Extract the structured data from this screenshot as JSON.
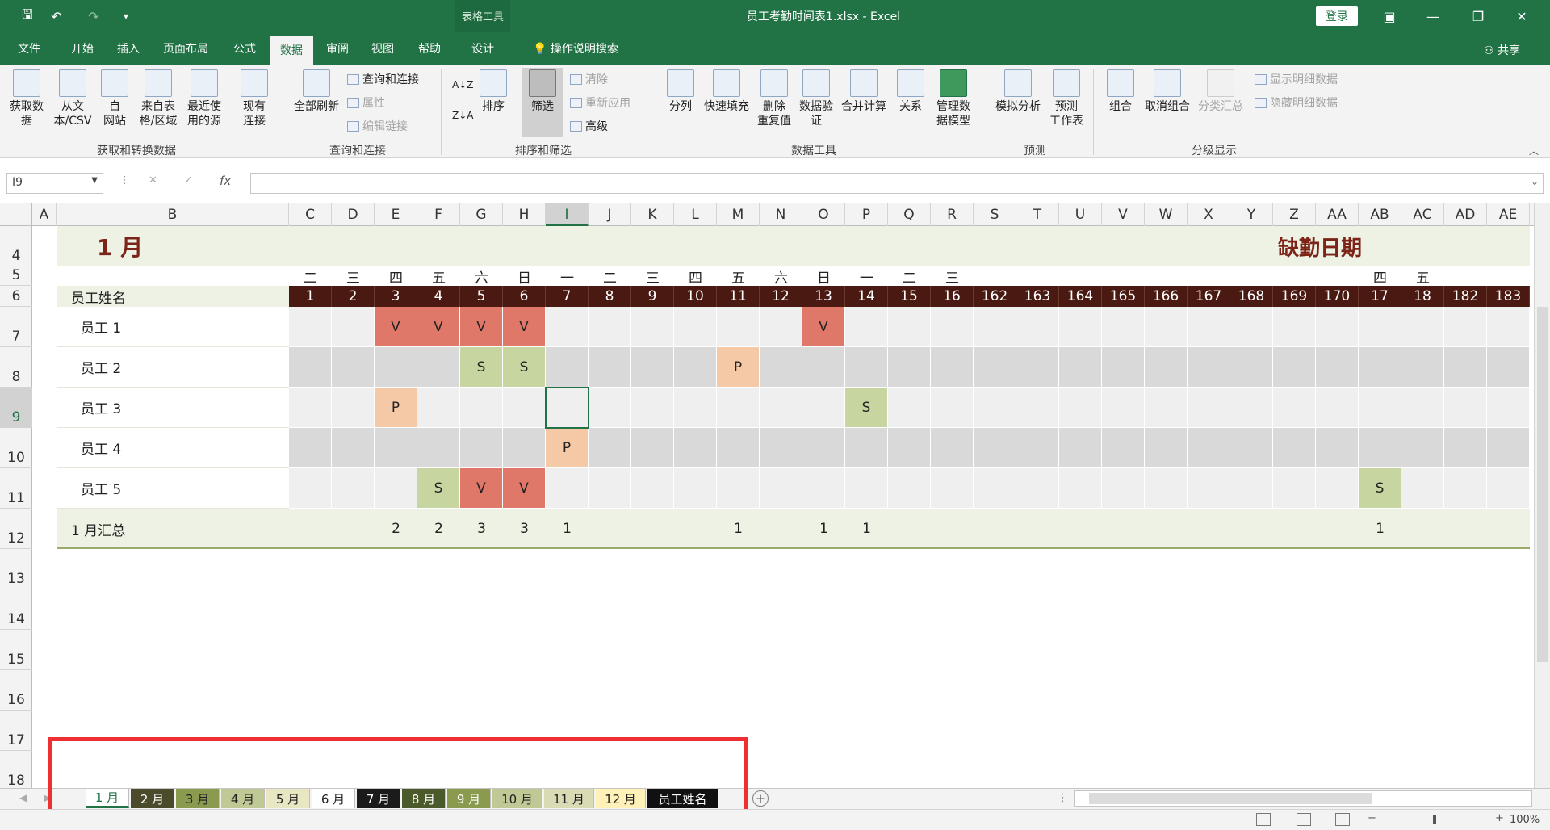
{
  "window": {
    "doc_title": "员工考勤时间表1.xlsx  -  Excel",
    "contextual_group": "表格工具",
    "login": "登录",
    "share": "共享"
  },
  "tabs": [
    "文件",
    "开始",
    "插入",
    "页面布局",
    "公式",
    "数据",
    "审阅",
    "视图",
    "帮助",
    "设计"
  ],
  "tell_me": "操作说明搜索",
  "ribbon": {
    "get_data": "获取数\n据",
    "from_csv": "从文\n本/CSV",
    "from_web": "自\n网站",
    "from_table": "来自表\n格/区域",
    "recent": "最近使\n用的源",
    "existing": "现有\n连接",
    "refresh_all": "全部刷新",
    "queries": "查询和连接",
    "properties": "属性",
    "edit_links": "编辑链接",
    "sort": "排序",
    "filter": "筛选",
    "clear": "清除",
    "reapply": "重新应用",
    "advanced": "高级",
    "split": "分列",
    "flash_fill": "快速填充",
    "remove_dup": "删除\n重复值",
    "validation": "数据验\n证",
    "consolidate": "合并计算",
    "relationships": "关系",
    "data_model": "管理数\n据模型",
    "what_if": "模拟分析",
    "forecast": "预测\n工作表",
    "group": "组合",
    "ungroup": "取消组合",
    "subtotal": "分类汇总",
    "show_detail": "显示明细数据",
    "hide_detail": "隐藏明细数据",
    "groups": [
      "获取和转换数据",
      "查询和连接",
      "排序和筛选",
      "数据工具",
      "预测",
      "分级显示"
    ]
  },
  "name_box": "I9",
  "fx": "fx",
  "columns": [
    "A",
    "B",
    "C",
    "D",
    "E",
    "F",
    "G",
    "H",
    "I",
    "J",
    "K",
    "L",
    "M",
    "N",
    "O",
    "P",
    "Q",
    "R",
    "S",
    "T",
    "U",
    "V",
    "W",
    "X",
    "Y",
    "Z",
    "AA",
    "AB",
    "AC",
    "AD",
    "AE"
  ],
  "rows": [
    "4",
    "5",
    "6",
    "7",
    "8",
    "9",
    "10",
    "11",
    "12",
    "13",
    "14",
    "15",
    "16",
    "17",
    "18"
  ],
  "month_title": "1 月",
  "absence_title": "缺勤日期",
  "weekdays": [
    "二",
    "三",
    "四",
    "五",
    "六",
    "日",
    "一",
    "二",
    "三",
    "四",
    "五",
    "六",
    "日",
    "一",
    "二",
    "三",
    "",
    "",
    "",
    "",
    "",
    "",
    "",
    "",
    "",
    "四",
    "五",
    "",
    ""
  ],
  "day_header_label": "员工姓名",
  "days": [
    "1",
    "2",
    "3",
    "4",
    "5",
    "6",
    "7",
    "8",
    "9",
    "10",
    "11",
    "12",
    "13",
    "14",
    "15",
    "16",
    "162",
    "163",
    "164",
    "165",
    "166",
    "167",
    "168",
    "169",
    "170",
    "17",
    "18",
    "182",
    "183"
  ],
  "employees": [
    {
      "name": "员工 1",
      "marks": {
        "2": "V",
        "3": "V",
        "4": "V",
        "5": "V",
        "12": "V"
      }
    },
    {
      "name": "员工 2",
      "marks": {
        "4": "S",
        "5": "S",
        "10": "P"
      }
    },
    {
      "name": "员工 3",
      "marks": {
        "2": "P",
        "13": "S"
      }
    },
    {
      "name": "员工 4",
      "marks": {
        "6": "P"
      }
    },
    {
      "name": "员工 5",
      "marks": {
        "3": "S",
        "4": "V",
        "5": "V",
        "25": "S"
      }
    }
  ],
  "summary": {
    "label": "1 月汇总",
    "values": {
      "2": "2",
      "3": "2",
      "4": "3",
      "5": "3",
      "6": "1",
      "10": "1",
      "12": "1",
      "13": "1",
      "25": "1"
    }
  },
  "colors": {
    "V": "#e0786a",
    "S": "#c7d6a0",
    "P": "#f6c9a6",
    "day_header": "#4a1a12",
    "title": "#7b2417",
    "band": "#eef2e4"
  },
  "sheet_tabs": [
    "1 月",
    "2 月",
    "3 月",
    "4 月",
    "5 月",
    "6 月",
    "7 月",
    "8 月",
    "9 月",
    "10 月",
    "11 月",
    "12 月",
    "员工姓名"
  ],
  "zoom": "100%"
}
